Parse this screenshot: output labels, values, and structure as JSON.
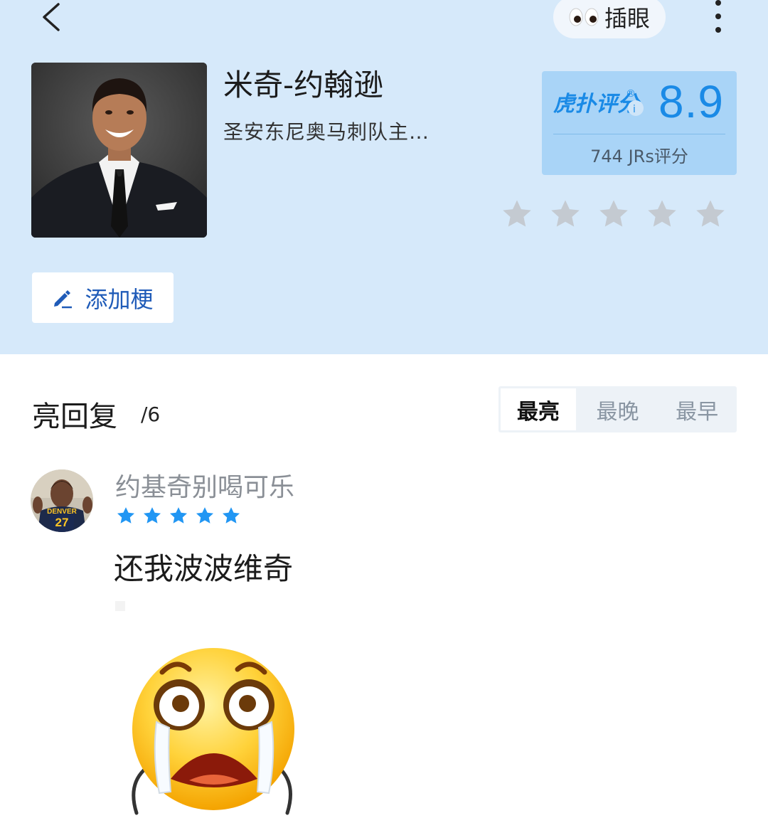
{
  "header": {
    "peek_label": "插眼",
    "name": "米奇-约翰逊",
    "description": "圣安东尼奥马刺队主…",
    "score": {
      "logo_text": "虎扑评分",
      "value": "8.9",
      "count_text": "744 JRs评分"
    },
    "rating_stars_filled": 0,
    "rating_stars_total": 5,
    "add_meme_label": "添加梗"
  },
  "replies": {
    "title": "亮回复",
    "count": "/6",
    "sort_tabs": [
      "最亮",
      "最晚",
      "最早"
    ],
    "active_tab": 0
  },
  "reply": {
    "username": "约基奇别喝可乐",
    "stars": 5,
    "text": "还我波波维奇",
    "jersey_text": "DENVER",
    "jersey_number": "27"
  },
  "colors": {
    "header_bg": "#d6e9fa",
    "score_bg": "#a9d4f7",
    "score_accent": "#1a8ae6",
    "star_blue": "#2196f3",
    "star_gray": "#c4cad1"
  }
}
